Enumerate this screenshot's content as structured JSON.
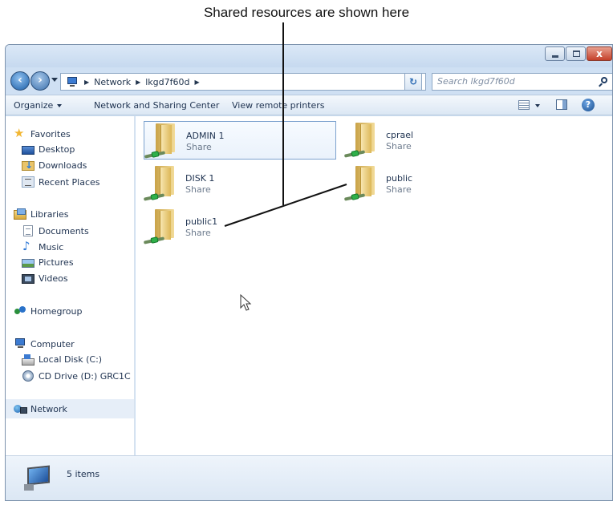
{
  "caption": "Shared resources are shown here",
  "titlebar": {
    "buttons": [
      "minimize-icon",
      "maximize-icon",
      "close-icon"
    ],
    "close_glyph": "x"
  },
  "address": {
    "crumbs": [
      "Network",
      "lkgd7f60d"
    ],
    "refresh_glyph": "↻",
    "search_placeholder": "Search lkgd7f60d"
  },
  "toolbar": {
    "organize": "Organize",
    "network_sharing": "Network and Sharing Center",
    "view_printers": "View remote printers",
    "help_glyph": "?"
  },
  "nav": {
    "favorites": "Favorites",
    "desktop": "Desktop",
    "downloads": "Downloads",
    "recent": "Recent Places",
    "libraries": "Libraries",
    "documents": "Documents",
    "music": "Music",
    "pictures": "Pictures",
    "videos": "Videos",
    "homegroup": "Homegroup",
    "computer": "Computer",
    "local_disk": "Local Disk (C:)",
    "cd_drive": "CD Drive (D:) GRC1C",
    "network": "Network"
  },
  "shares": [
    {
      "name": "ADMIN 1",
      "type": "Share"
    },
    {
      "name": "cprael",
      "type": "Share"
    },
    {
      "name": "DISK 1",
      "type": "Share"
    },
    {
      "name": "public",
      "type": "Share"
    },
    {
      "name": "public1",
      "type": "Share"
    }
  ],
  "status": {
    "count": "5 items"
  },
  "colors": {
    "window_chrome": "#cfe0f3",
    "selection_border": "#7da2ce",
    "text": "#1e3250"
  }
}
